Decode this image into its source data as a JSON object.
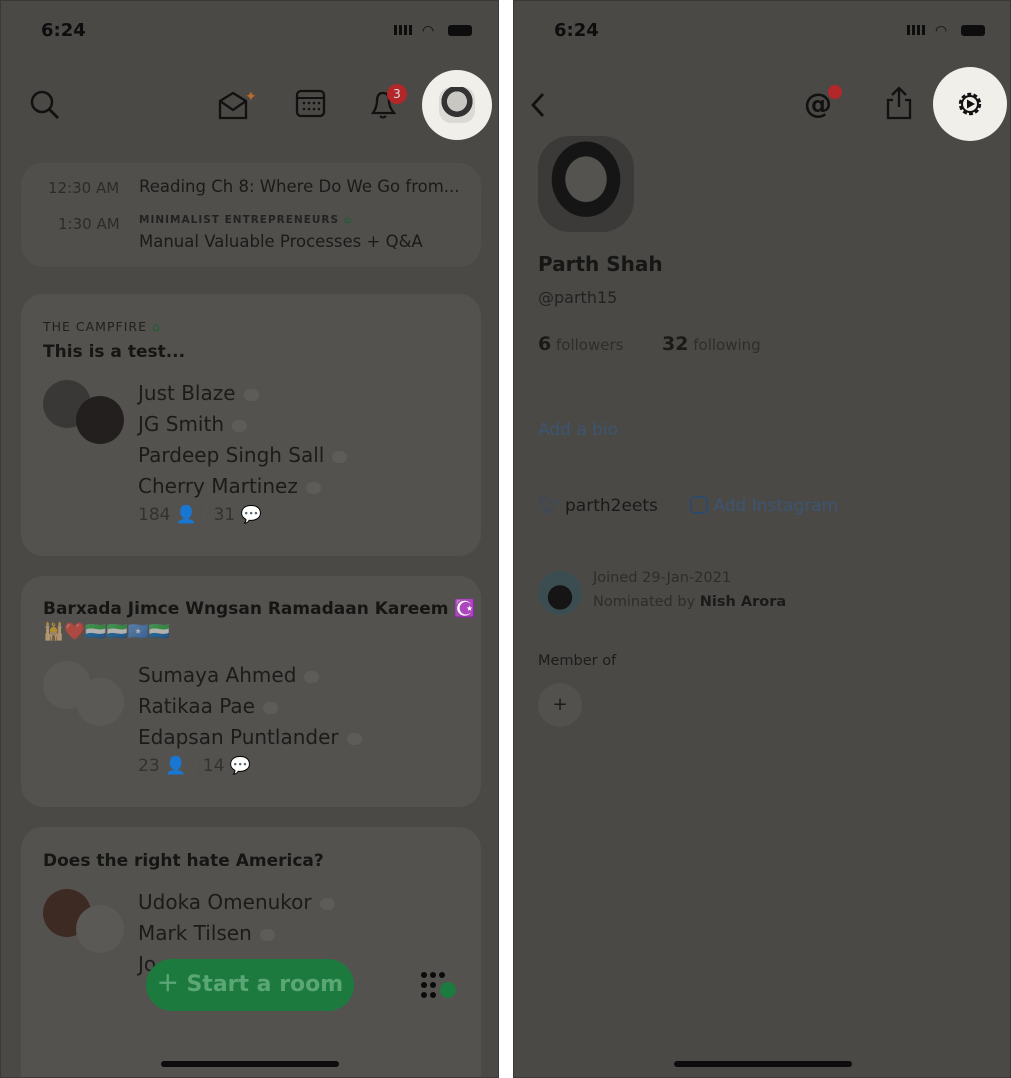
{
  "left": {
    "status_time": "6:24",
    "notification_count": "3",
    "upcoming": [
      {
        "time": "12:30 AM",
        "club": "",
        "title": "Reading Ch 8: Where Do We Go from..."
      },
      {
        "time": "1:30 AM",
        "club": "MINIMALIST ENTREPRENEURS",
        "title": "Manual Valuable Processes + Q&A"
      }
    ],
    "rooms": [
      {
        "club": "THE CAMPFIRE",
        "title": "This is a test...",
        "speakers": [
          "Just Blaze",
          "JG Smith",
          "Pardeep Singh Sall",
          "Cherry Martinez"
        ],
        "listeners": "184",
        "speakers_count": "31"
      },
      {
        "club": "",
        "title": "Barxada Jimce Wngsan Ramadaan Kareem ☪️",
        "title2": "🕌❤️🇸🇱🇸🇱🇸🇴🇸🇱",
        "speakers": [
          "Sumaya Ahmed",
          "Ratikaa Pae",
          "Edapsan Puntlander"
        ],
        "listeners": "23",
        "speakers_count": "14"
      },
      {
        "club": "",
        "title": "Does the right hate America?",
        "speakers": [
          "Udoka Omenukor",
          "Mark Tilsen",
          "Jo"
        ]
      }
    ],
    "start_room": "Start a room",
    "colors": {
      "accent": "#1d7a3f",
      "badge": "#b3262a"
    }
  },
  "right": {
    "status_time": "6:24",
    "name": "Parth Shah",
    "username": "@parth15",
    "followers_count": "6",
    "followers_label": "followers",
    "following_count": "32",
    "following_label": "following",
    "add_bio": "Add a bio",
    "twitter": "parth2eets",
    "instagram": "Add Instagram",
    "joined": "Joined 29-Jan-2021",
    "nominated_prefix": "Nominated by ",
    "nominated_by": "Nish Arora",
    "member_of": "Member of",
    "add_club": "+"
  }
}
